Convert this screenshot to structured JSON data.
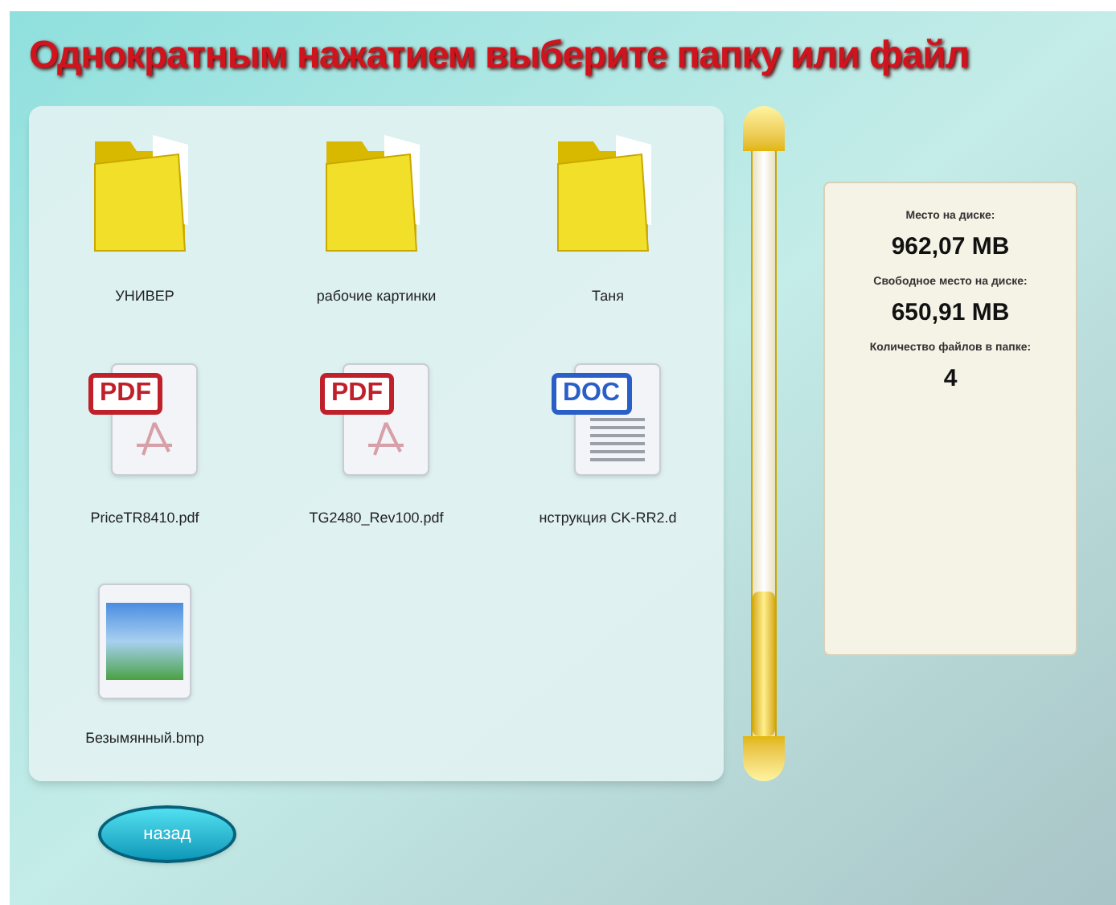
{
  "title": "Однократным нажатием выберите папку или файл",
  "items": [
    {
      "kind": "folder",
      "name": "УНИВЕР"
    },
    {
      "kind": "folder",
      "name": "рабочие картинки"
    },
    {
      "kind": "folder",
      "name": "Таня"
    },
    {
      "kind": "pdf",
      "badge": "PDF",
      "name": "PriceTR8410.pdf"
    },
    {
      "kind": "pdf",
      "badge": "PDF",
      "name": "TG2480_Rev100.pdf"
    },
    {
      "kind": "doc",
      "badge": "DOC",
      "name": "нструкция CK-RR2.d"
    },
    {
      "kind": "image",
      "name": "Безымянный.bmp"
    }
  ],
  "disk_info": [
    {
      "label": "Место на диске:",
      "value": "962,07 MB"
    },
    {
      "label": "Свободное место на диске:",
      "value": "650,91 MB"
    },
    {
      "label": "Количество файлов в папке:",
      "value": "4"
    }
  ],
  "back_button": "назад"
}
